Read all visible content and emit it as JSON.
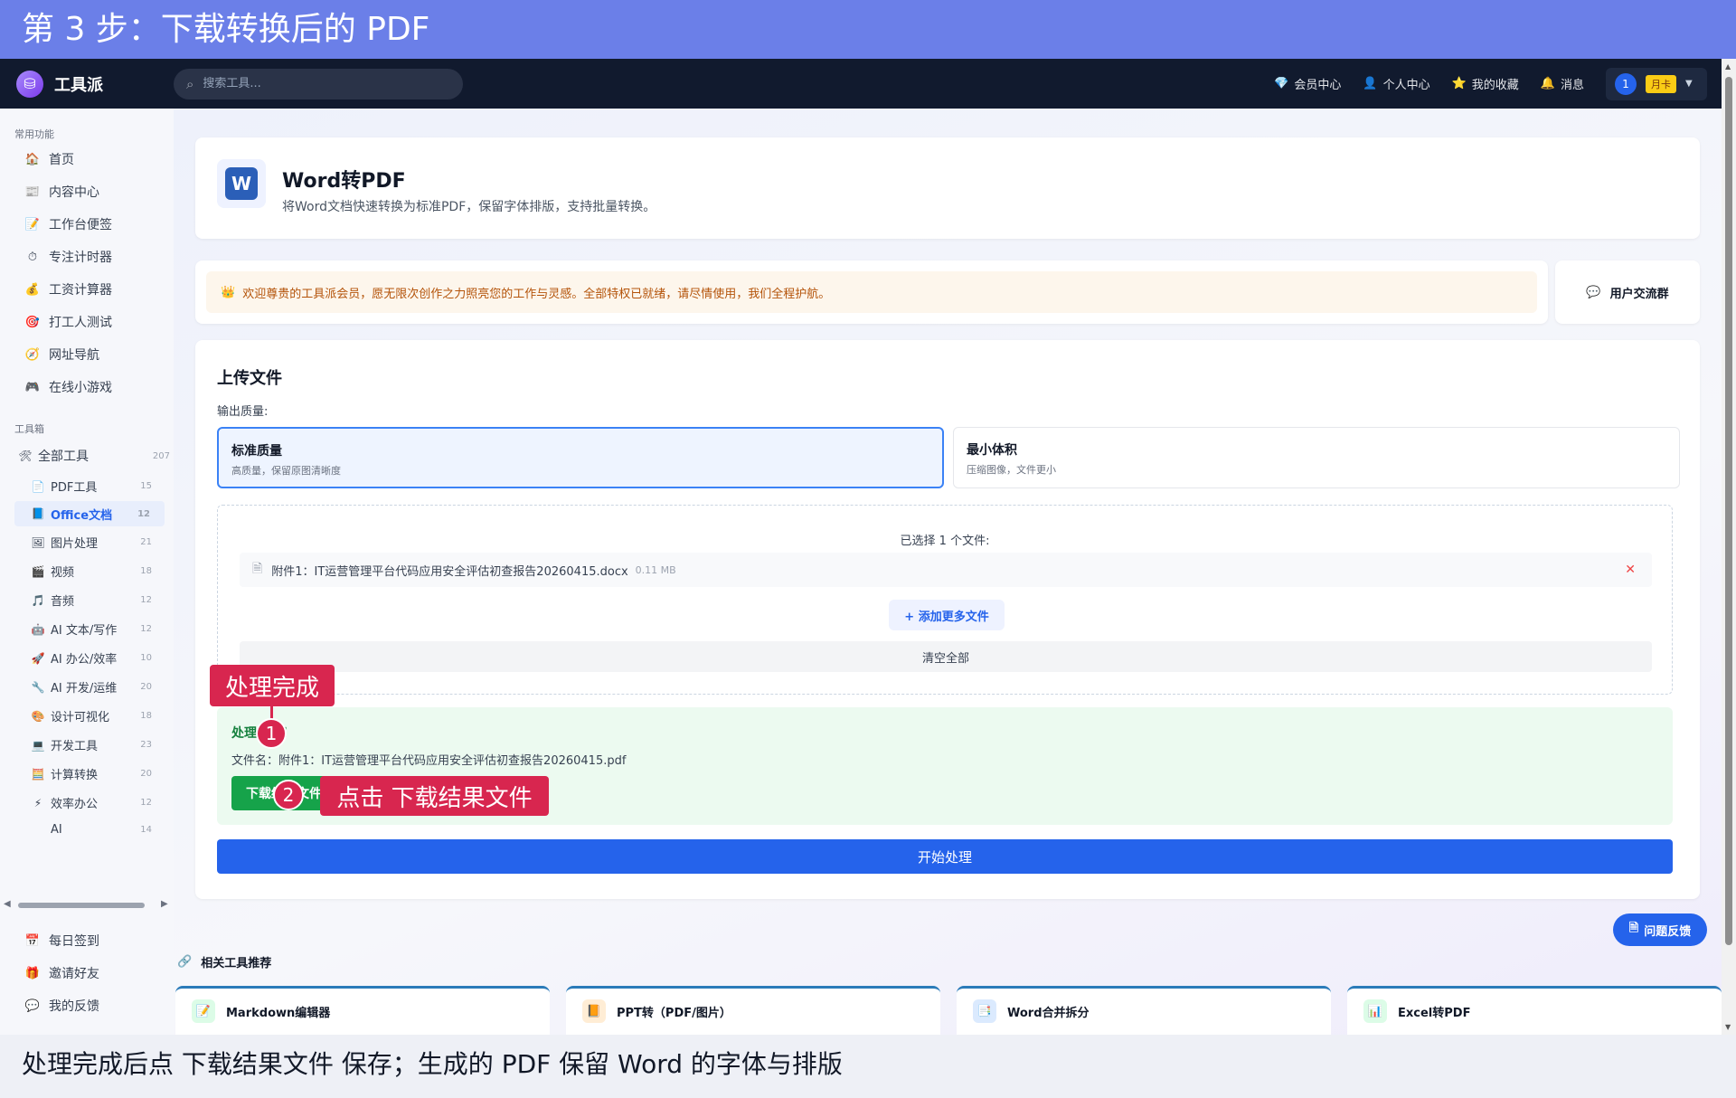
{
  "banner": {
    "text": "第 3 步：下载转换后的 PDF"
  },
  "navbar": {
    "brand": "工具派",
    "search_placeholder": "搜索工具...",
    "links": [
      {
        "icon": "💎",
        "label": "会员中心"
      },
      {
        "icon": "👤",
        "label": "个人中心"
      },
      {
        "icon": "⭐",
        "label": "我的收藏"
      },
      {
        "icon": "🔔",
        "label": "消息"
      }
    ],
    "user": {
      "badge": "1",
      "tag": "月卡"
    }
  },
  "sidebar": {
    "common_title": "常用功能",
    "common": [
      {
        "icon": "🏠",
        "label": "首页"
      },
      {
        "icon": "📰",
        "label": "内容中心"
      },
      {
        "icon": "📝",
        "label": "工作台便签"
      },
      {
        "icon": "⏱",
        "label": "专注计时器"
      },
      {
        "icon": "💰",
        "label": "工资计算器"
      },
      {
        "icon": "🎯",
        "label": "打工人测试"
      },
      {
        "icon": "🧭",
        "label": "网址导航"
      },
      {
        "icon": "🎮",
        "label": "在线小游戏"
      }
    ],
    "toolbox_title": "工具箱",
    "all_tools": {
      "icon": "🛠",
      "label": "全部工具",
      "count": "207"
    },
    "tools": [
      {
        "icon": "📄",
        "label": "PDF工具",
        "count": "15"
      },
      {
        "icon": "📘",
        "label": "Office文档",
        "count": "12",
        "active": true
      },
      {
        "icon": "🖼",
        "label": "图片处理",
        "count": "21"
      },
      {
        "icon": "🎬",
        "label": "视频",
        "count": "18"
      },
      {
        "icon": "🎵",
        "label": "音频",
        "count": "12"
      },
      {
        "icon": "🤖",
        "label": "AI 文本/写作",
        "count": "12"
      },
      {
        "icon": "🚀",
        "label": "AI 办公/效率",
        "count": "10"
      },
      {
        "icon": "🔧",
        "label": "AI 开发/运维",
        "count": "20"
      },
      {
        "icon": "🎨",
        "label": "设计可视化",
        "count": "18"
      },
      {
        "icon": "💻",
        "label": "开发工具",
        "count": "23"
      },
      {
        "icon": "🧮",
        "label": "计算转换",
        "count": "20"
      },
      {
        "icon": "⚡",
        "label": "效率办公",
        "count": "12"
      },
      {
        "icon": "",
        "label": "AI",
        "count": "14"
      }
    ],
    "bottom": [
      {
        "icon": "📅",
        "label": "每日签到"
      },
      {
        "icon": "🎁",
        "label": "邀请好友"
      },
      {
        "icon": "💬",
        "label": "我的反馈"
      }
    ]
  },
  "tool": {
    "title": "Word转PDF",
    "description": "将Word文档快速转换为标准PDF，保留字体排版，支持批量转换。"
  },
  "welcome": {
    "icon": "👑",
    "text": "欢迎尊贵的工具派会员，愿无限次创作之力照亮您的工作与灵感。全部特权已就绪，请尽情使用，我们全程护航。",
    "group_button": "用户交流群"
  },
  "upload": {
    "title": "上传文件",
    "quality_label": "输出质量:",
    "qualities": [
      {
        "title": "标准质量",
        "subtitle": "高质量，保留原图清晰度",
        "selected": true
      },
      {
        "title": "最小体积",
        "subtitle": "压缩图像，文件更小",
        "selected": false
      }
    ],
    "selected_count": "已选择 1 个文件:",
    "file": {
      "name": "附件1：IT运营管理平台代码应用安全评估初查报告20260415.docx",
      "size": "0.11 MB"
    },
    "add_more": "+ 添加更多文件",
    "clear_all": "清空全部"
  },
  "result": {
    "title": "处理完成！",
    "file_label": "文件名：附件1：IT运营管理平台代码应用安全评估初查报告20260415.pdf",
    "download": "下载结果文件"
  },
  "start_button": "开始处理",
  "annotations": {
    "callout1": "处理完成",
    "marker1": "1",
    "callout2": "点击 下载结果文件",
    "marker2": "2"
  },
  "feedback_button": "问题反馈",
  "related": {
    "title": "相关工具推荐",
    "items": [
      {
        "label": "Markdown编辑器",
        "icon": "📝",
        "color": "#16a34a"
      },
      {
        "label": "PPT转（PDF/图片）",
        "icon": "📙",
        "color": "#ea580c"
      },
      {
        "label": "Word合并拆分",
        "icon": "📑",
        "color": "#2563eb"
      },
      {
        "label": "Excel转PDF",
        "icon": "📊",
        "color": "#16a34a"
      }
    ]
  },
  "caption": "处理完成后点 下载结果文件 保存；生成的 PDF 保留 Word 的字体与排版"
}
